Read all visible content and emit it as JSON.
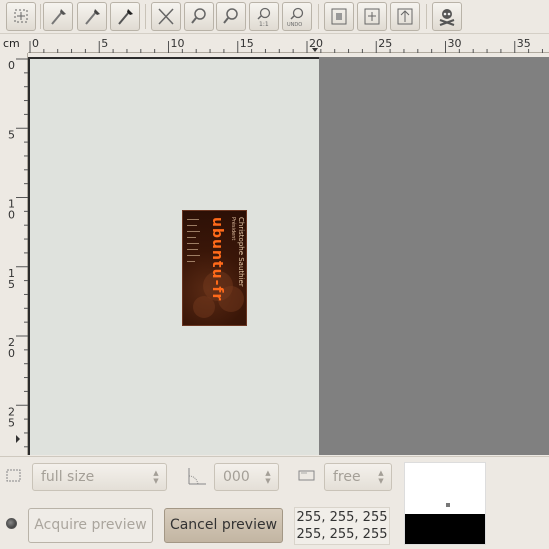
{
  "toolbar": {
    "buttons": [
      {
        "name": "select-area-tool-button",
        "icon": "select-area-icon"
      },
      {
        "name": "pick-white-point-button",
        "icon": "eyedropper-white-icon"
      },
      {
        "name": "pick-gray-point-button",
        "icon": "eyedropper-gray-icon"
      },
      {
        "name": "pick-black-point-button",
        "icon": "eyedropper-black-icon"
      },
      {
        "name": "zoom-out-full-button",
        "icon": "zoom-reset-icon"
      },
      {
        "name": "zoom-in-button",
        "icon": "zoom-in-icon"
      },
      {
        "name": "zoom-out-button",
        "icon": "zoom-out-icon"
      },
      {
        "name": "zoom-1-1-button",
        "icon": "zoom-1-1-icon",
        "label": "1:1"
      },
      {
        "name": "zoom-undo-button",
        "icon": "zoom-undo-icon",
        "label": "UNDO"
      },
      {
        "name": "autoselect-full-button",
        "icon": "autoselect-full-icon"
      },
      {
        "name": "autoselect-button",
        "icon": "autoselect-icon"
      },
      {
        "name": "autoraise-button",
        "icon": "autoraise-icon"
      },
      {
        "name": "delete-images-button",
        "icon": "skull-icon"
      }
    ]
  },
  "ruler": {
    "unit": "cm",
    "horizontal_labels": [
      "0",
      "5",
      "10",
      "15",
      "20",
      "25",
      "30",
      "35"
    ],
    "vertical_labels": [
      [
        "0"
      ],
      [
        "5"
      ],
      [
        "1",
        "0"
      ],
      [
        "1",
        "5"
      ],
      [
        "2",
        "0"
      ],
      [
        "2",
        "5"
      ]
    ]
  },
  "card": {
    "name": "Christophe Sauthier",
    "role": "Président",
    "brand": "ubuntu-fr"
  },
  "bottom": {
    "size_select": "full size",
    "rotation_select": "000",
    "ratio_select": "free",
    "acquire_preview_label": "Acquire preview",
    "cancel_preview_label": "Cancel preview",
    "pixel_value_top": "255, 255, 255",
    "pixel_value_bottom": "255, 255, 255"
  }
}
